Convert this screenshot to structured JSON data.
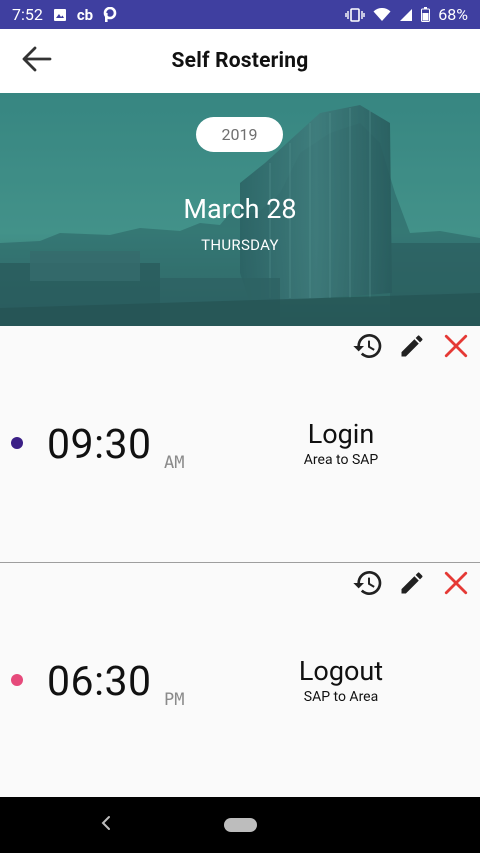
{
  "status": {
    "time": "7:52",
    "battery": "68%",
    "notif_icons": [
      "image-icon",
      "cb-icon",
      "p-icon"
    ],
    "right_icons": [
      "vibrate-icon",
      "wifi-icon",
      "signal-icon",
      "battery-icon"
    ]
  },
  "app_bar": {
    "title": "Self Rostering",
    "back_icon": "arrow-back-icon"
  },
  "hero": {
    "year": "2019",
    "date": "March 28",
    "weekday": "THURSDAY"
  },
  "entries": [
    {
      "time": "09:30",
      "meridiem": "AM",
      "label": "Login",
      "sub": "Area to SAP",
      "dot_color": "#3b1f86"
    },
    {
      "time": "06:30",
      "meridiem": "PM",
      "label": "Logout",
      "sub": "SAP to Area",
      "dot_color": "#e64a7b"
    }
  ],
  "colors": {
    "status_bar": "#3f3fa0",
    "delete_icon": "#e53935",
    "icon_dark": "#212121"
  },
  "actions": [
    "history-icon",
    "edit-icon",
    "close-icon"
  ]
}
